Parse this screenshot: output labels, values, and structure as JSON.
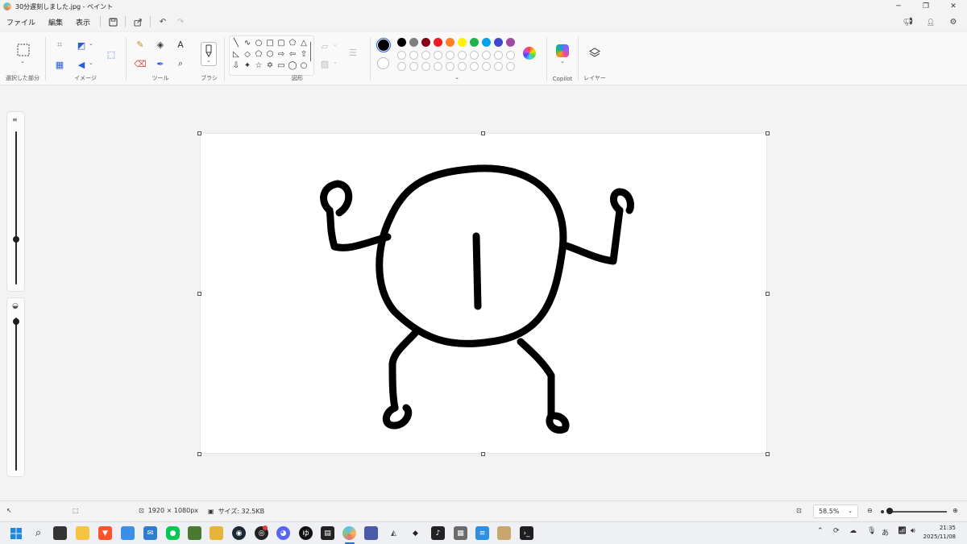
{
  "window": {
    "title": "30分遅刻しました.jpg - ペイント",
    "minimize_icon": "minimize-icon",
    "maximize_icon": "restore-icon",
    "close_icon": "close-icon"
  },
  "menu": {
    "items": [
      "ファイル",
      "編集",
      "表示"
    ]
  },
  "ribbon": {
    "groups": {
      "selection": "選択した部分",
      "image": "イメージ",
      "tools": "ツール",
      "brushes": "ブラシ",
      "shapes": "図形",
      "copilot": "Copilot",
      "layers": "レイヤー"
    },
    "colors": {
      "primary": "#000000",
      "secondary": "#ffffff",
      "palette_row1": [
        "#000000",
        "#7f7f7f",
        "#880015",
        "#ed1c24",
        "#ff7f27",
        "#fff200",
        "#22b14c",
        "#00a2e8",
        "#3f48cc",
        "#a349a4"
      ],
      "palette_row2": [
        "#ffffff",
        "#c3c3c3",
        "#b97a57",
        "#ffaec9",
        "#ffc90e",
        "#efe4b0",
        "#b5e61d",
        "#99d9ea",
        "#7092be",
        "#c8bfe7"
      ]
    }
  },
  "status": {
    "dimensions": "1920 × 1080px",
    "size": "サイズ: 32.5KB",
    "zoom": "58.5%"
  },
  "taskbar": {
    "time": "21:35",
    "date": "2025/11/08",
    "ime": "あ"
  }
}
